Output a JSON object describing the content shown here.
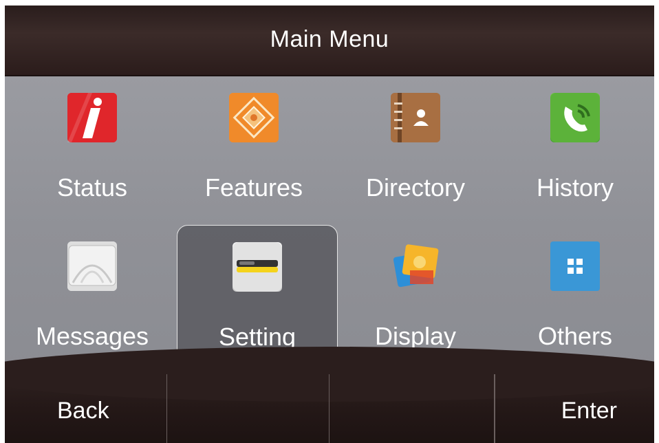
{
  "header": {
    "title": "Main Menu"
  },
  "menu": {
    "items": [
      {
        "label": "Status",
        "icon": "info-icon"
      },
      {
        "label": "Features",
        "icon": "features-icon"
      },
      {
        "label": "Directory",
        "icon": "directory-icon"
      },
      {
        "label": "History",
        "icon": "phone-history-icon"
      },
      {
        "label": "Messages",
        "icon": "envelope-icon"
      },
      {
        "label": "Setting",
        "icon": "settings-icon",
        "selected": true
      },
      {
        "label": "Display",
        "icon": "display-icon"
      },
      {
        "label": "Others",
        "icon": "grid-icon"
      }
    ]
  },
  "softkeys": [
    {
      "label": "Back"
    },
    {
      "label": ""
    },
    {
      "label": ""
    },
    {
      "label": "Enter"
    }
  ],
  "colors": {
    "title_bar": "#2a1d1c",
    "grid_bg": "#8f9096",
    "text": "#ffffff",
    "selection_border": "#e6e6e6"
  }
}
